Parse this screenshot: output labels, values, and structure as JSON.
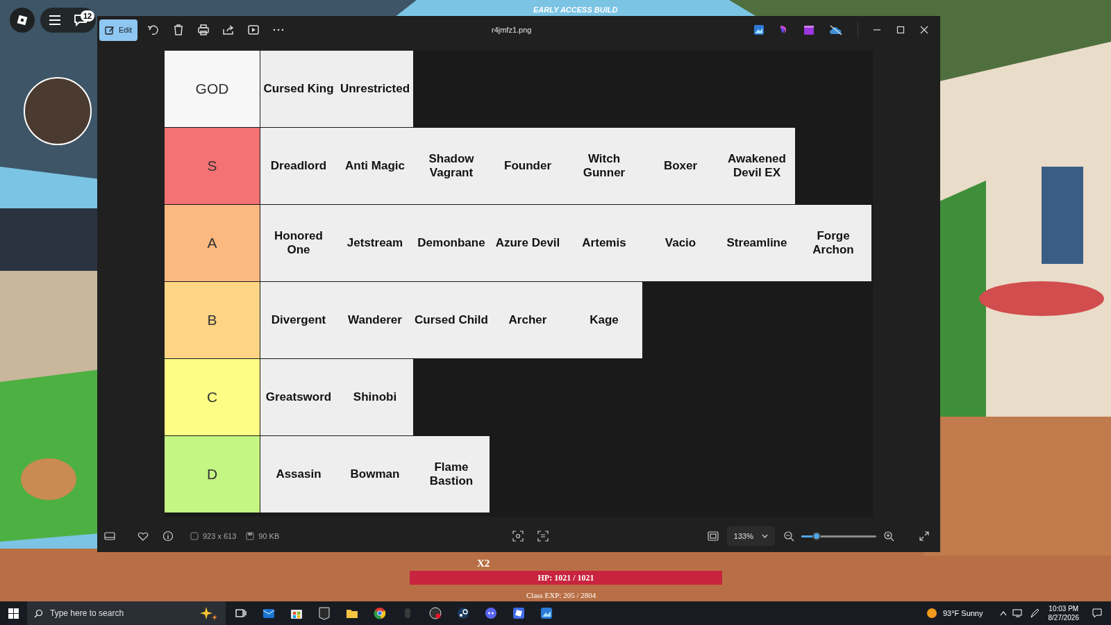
{
  "game_hud": {
    "build_label": "EARLY ACCESS BUILD",
    "chat_badge": "12",
    "multiplier": "X2",
    "hp": "HP: 1021 / 1021",
    "class_exp": "Class EXP: 205 / 2804"
  },
  "viewer": {
    "title": "r4jmfz1.png",
    "edit_label": "Edit",
    "dimensions": "923 x 613",
    "file_size": "90 KB",
    "zoom": "133%",
    "zoom_slider": {
      "level": 0.2
    }
  },
  "tier_list": {
    "tiers": [
      {
        "label": "GOD",
        "color": "#f7f7f7",
        "items": [
          "Cursed King",
          "Unrestricted"
        ]
      },
      {
        "label": "S",
        "color": "#f47174",
        "items": [
          "Dreadlord",
          "Anti Magic",
          "Shadow Vagrant",
          "Founder",
          "Witch Gunner",
          "Boxer",
          "Awakened Devil EX"
        ]
      },
      {
        "label": "A",
        "color": "#fbb981",
        "items": [
          "Honored One",
          "Jetstream",
          "Demonbane",
          "Azure Devil",
          "Artemis",
          "Vacio",
          "Streamline",
          "Forge Archon"
        ]
      },
      {
        "label": "B",
        "color": "#fdd584",
        "items": [
          "Divergent",
          "Wanderer",
          "Cursed Child",
          "Archer",
          "Kage"
        ]
      },
      {
        "label": "C",
        "color": "#fdfd85",
        "items": [
          "Greatsword",
          "Shinobi"
        ]
      },
      {
        "label": "D",
        "color": "#c4f683",
        "items": [
          "Assasin",
          "Bowman",
          "Flame Bastion"
        ]
      }
    ]
  },
  "taskbar": {
    "search_placeholder": "Type here to search",
    "weather": "93°F Sunny",
    "time": "10:03 PM",
    "date": "8/27/2026"
  }
}
